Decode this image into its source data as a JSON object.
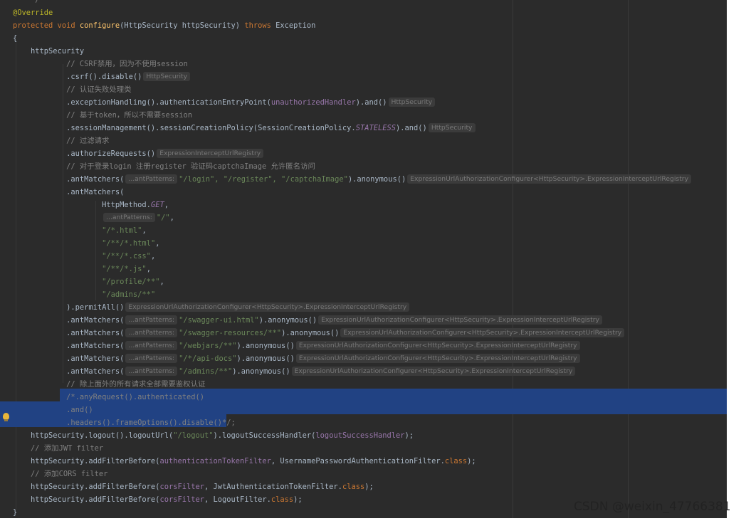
{
  "code": {
    "lines": [
      [
        {
          "c": "t-cm",
          "t": "    */"
        }
      ],
      [
        {
          "c": "t-ann",
          "t": "@Override"
        }
      ],
      [
        {
          "c": "t-kw",
          "t": "protected void "
        },
        {
          "c": "t-fn",
          "t": "configure"
        },
        {
          "c": "",
          "t": "(HttpSecurity httpSecurity) "
        },
        {
          "c": "t-kw",
          "t": "throws "
        },
        {
          "c": "",
          "t": "Exception"
        }
      ],
      [
        {
          "c": "",
          "t": "{"
        }
      ],
      [
        {
          "c": "",
          "t": "    httpSecurity"
        }
      ],
      [
        {
          "c": "t-cm",
          "t": "            // CSRF禁用，因为不使用session"
        }
      ],
      [
        {
          "c": "",
          "t": "            .csrf().disable()"
        },
        {
          "c": "t-hint",
          "t": "HttpSecurity"
        }
      ],
      [
        {
          "c": "t-cm",
          "t": "            // 认证失败处理类"
        }
      ],
      [
        {
          "c": "",
          "t": "            .exceptionHandling().authenticationEntryPoint("
        },
        {
          "c": "t-fld",
          "t": "unauthorizedHandler"
        },
        {
          "c": "",
          "t": ").and()"
        },
        {
          "c": "t-hint",
          "t": "HttpSecurity"
        }
      ],
      [
        {
          "c": "t-cm",
          "t": "            // 基于token，所以不需要session"
        }
      ],
      [
        {
          "c": "",
          "t": "            .sessionManagement().sessionCreationPolicy(SessionCreationPolicy."
        },
        {
          "c": "t-const",
          "t": "STATELESS"
        },
        {
          "c": "",
          "t": ").and()"
        },
        {
          "c": "t-hint",
          "t": "HttpSecurity"
        }
      ],
      [
        {
          "c": "t-cm",
          "t": "            // 过滤请求"
        }
      ],
      [
        {
          "c": "",
          "t": "            .authorizeRequests()"
        },
        {
          "c": "t-hint",
          "t": "ExpressionInterceptUrlRegistry"
        }
      ],
      [
        {
          "c": "t-cm",
          "t": "            // 对于登录login 注册register 验证码captchaImage 允许匿名访问"
        }
      ],
      [
        {
          "c": "",
          "t": "            .antMatchers("
        },
        {
          "c": "t-hint",
          "t": "...antPatterns:"
        },
        {
          "c": "t-str",
          "t": "\"/login\", \"/register\", \"/captchaImage\""
        },
        {
          "c": "",
          "t": ").anonymous()"
        },
        {
          "c": "t-hint",
          "t": "ExpressionUrlAuthorizationConfigurer<HttpSecurity>.ExpressionInterceptUrlRegistry"
        }
      ],
      [
        {
          "c": "",
          "t": "            .antMatchers("
        }
      ],
      [
        {
          "c": "",
          "t": "                    HttpMethod."
        },
        {
          "c": "t-const",
          "t": "GET"
        },
        {
          "c": "",
          "t": ","
        }
      ],
      [
        {
          "c": "",
          "t": "                    "
        },
        {
          "c": "t-hint",
          "t": "...antPatterns:"
        },
        {
          "c": "t-str",
          "t": "\"/\""
        },
        {
          "c": "",
          "t": ","
        }
      ],
      [
        {
          "c": "",
          "t": "                    "
        },
        {
          "c": "t-str",
          "t": "\"/*.html\""
        },
        {
          "c": "",
          "t": ","
        }
      ],
      [
        {
          "c": "",
          "t": "                    "
        },
        {
          "c": "t-str",
          "t": "\"/**/*.html\""
        },
        {
          "c": "",
          "t": ","
        }
      ],
      [
        {
          "c": "",
          "t": "                    "
        },
        {
          "c": "t-str",
          "t": "\"/**/*.css\""
        },
        {
          "c": "",
          "t": ","
        }
      ],
      [
        {
          "c": "",
          "t": "                    "
        },
        {
          "c": "t-str",
          "t": "\"/**/*.js\""
        },
        {
          "c": "",
          "t": ","
        }
      ],
      [
        {
          "c": "",
          "t": "                    "
        },
        {
          "c": "t-str",
          "t": "\"/profile/**\""
        },
        {
          "c": "",
          "t": ","
        }
      ],
      [
        {
          "c": "",
          "t": "                    "
        },
        {
          "c": "t-str",
          "t": "\"/admins/**\""
        }
      ],
      [
        {
          "c": "",
          "t": "            ).permitAll()"
        },
        {
          "c": "t-hint",
          "t": "ExpressionUrlAuthorizationConfigurer<HttpSecurity>.ExpressionInterceptUrlRegistry"
        }
      ],
      [
        {
          "c": "",
          "t": "            .antMatchers("
        },
        {
          "c": "t-hint",
          "t": "...antPatterns:"
        },
        {
          "c": "t-str",
          "t": "\"/swagger-ui.html\""
        },
        {
          "c": "",
          "t": ").anonymous()"
        },
        {
          "c": "t-hint",
          "t": "ExpressionUrlAuthorizationConfigurer<HttpSecurity>.ExpressionInterceptUrlRegistry"
        }
      ],
      [
        {
          "c": "",
          "t": "            .antMatchers("
        },
        {
          "c": "t-hint",
          "t": "...antPatterns:"
        },
        {
          "c": "t-str",
          "t": "\"/swagger-resources/**\""
        },
        {
          "c": "",
          "t": ").anonymous()"
        },
        {
          "c": "t-hint",
          "t": "ExpressionUrlAuthorizationConfigurer<HttpSecurity>.ExpressionInterceptUrlRegistry"
        }
      ],
      [
        {
          "c": "",
          "t": "            .antMatchers("
        },
        {
          "c": "t-hint",
          "t": "...antPatterns:"
        },
        {
          "c": "t-str",
          "t": "\"/webjars/**\""
        },
        {
          "c": "",
          "t": ").anonymous()"
        },
        {
          "c": "t-hint",
          "t": "ExpressionUrlAuthorizationConfigurer<HttpSecurity>.ExpressionInterceptUrlRegistry"
        }
      ],
      [
        {
          "c": "",
          "t": "            .antMatchers("
        },
        {
          "c": "t-hint",
          "t": "...antPatterns:"
        },
        {
          "c": "t-str",
          "t": "\"/*/api-docs\""
        },
        {
          "c": "",
          "t": ").anonymous()"
        },
        {
          "c": "t-hint",
          "t": "ExpressionUrlAuthorizationConfigurer<HttpSecurity>.ExpressionInterceptUrlRegistry"
        }
      ],
      [
        {
          "c": "",
          "t": "            .antMatchers("
        },
        {
          "c": "t-hint",
          "t": "...antPatterns:"
        },
        {
          "c": "t-str",
          "t": "\"/admins/**\""
        },
        {
          "c": "",
          "t": ").anonymous()"
        },
        {
          "c": "t-hint",
          "t": "ExpressionUrlAuthorizationConfigurer<HttpSecurity>.ExpressionInterceptUrlRegistry"
        }
      ],
      [
        {
          "c": "t-cm",
          "t": "            // 除上面外的所有请求全部需要鉴权认证"
        }
      ],
      [
        {
          "c": "t-cm",
          "t": "            /*.anyRequest().authenticated()"
        }
      ],
      [
        {
          "c": "t-cm",
          "t": "            .and()"
        }
      ],
      [
        {
          "c": "t-cm",
          "t": "            .headers().frameOptions().disable()*/;"
        }
      ],
      [
        {
          "c": "",
          "t": "    httpSecurity.logout().logoutUrl("
        },
        {
          "c": "t-str",
          "t": "\"/logout\""
        },
        {
          "c": "",
          "t": ").logoutSuccessHandler("
        },
        {
          "c": "t-fld",
          "t": "logoutSuccessHandler"
        },
        {
          "c": "",
          "t": ");"
        }
      ],
      [
        {
          "c": "t-cm",
          "t": "    // 添加JWT filter"
        }
      ],
      [
        {
          "c": "",
          "t": "    httpSecurity.addFilterBefore("
        },
        {
          "c": "t-fld",
          "t": "authenticationTokenFilter"
        },
        {
          "c": "",
          "t": ", UsernamePasswordAuthenticationFilter."
        },
        {
          "c": "t-kw",
          "t": "class"
        },
        {
          "c": "",
          "t": ");"
        }
      ],
      [
        {
          "c": "t-cm",
          "t": "    // 添加CORS filter"
        }
      ],
      [
        {
          "c": "",
          "t": "    httpSecurity.addFilterBefore("
        },
        {
          "c": "t-fld",
          "t": "corsFilter"
        },
        {
          "c": "",
          "t": ", JwtAuthenticationTokenFilter."
        },
        {
          "c": "t-kw",
          "t": "class"
        },
        {
          "c": "",
          "t": ");"
        }
      ],
      [
        {
          "c": "",
          "t": "    httpSecurity.addFilterBefore("
        },
        {
          "c": "t-fld",
          "t": "corsFilter"
        },
        {
          "c": "",
          "t": ", LogoutFilter."
        },
        {
          "c": "t-kw",
          "t": "class"
        },
        {
          "c": "",
          "t": ");"
        }
      ],
      [
        {
          "c": "",
          "t": "}"
        }
      ]
    ]
  },
  "selection_lines": [
    31,
    32,
    33
  ],
  "watermark": "CSDN @weixin_47766381",
  "colors": {
    "editor_bg": "#2b2b2b",
    "selection": "#214283",
    "keyword": "#cc7832",
    "string": "#6a8759",
    "comment": "#808080",
    "field": "#9876aa"
  },
  "icons": {
    "gutter": "lightbulb-icon"
  }
}
